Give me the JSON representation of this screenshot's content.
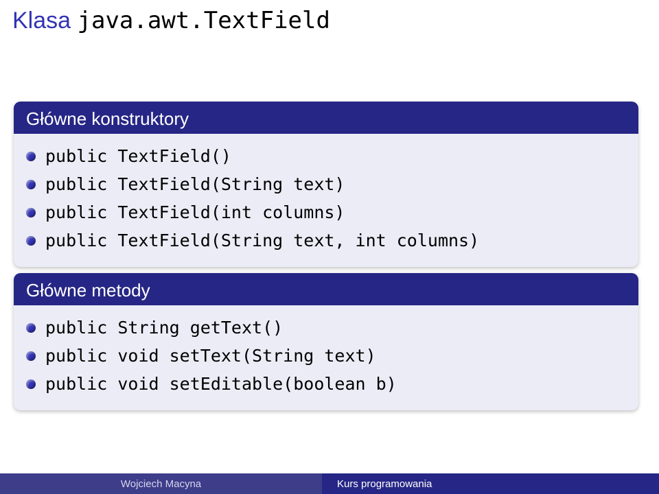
{
  "title": {
    "kw": "Klasa",
    "cls": "java.awt.TextField"
  },
  "block1": {
    "header": "Główne konstruktory",
    "items": [
      "public TextField()",
      "public TextField(String text)",
      "public TextField(int columns)",
      "public TextField(String text, int columns)"
    ]
  },
  "block2": {
    "header": "Główne metody",
    "items": [
      "public String getText()",
      "public void setText(String text)",
      "public void setEditable(boolean b)"
    ]
  },
  "footer": {
    "left": "Wojciech Macyna",
    "right": "Kurs programowania"
  }
}
